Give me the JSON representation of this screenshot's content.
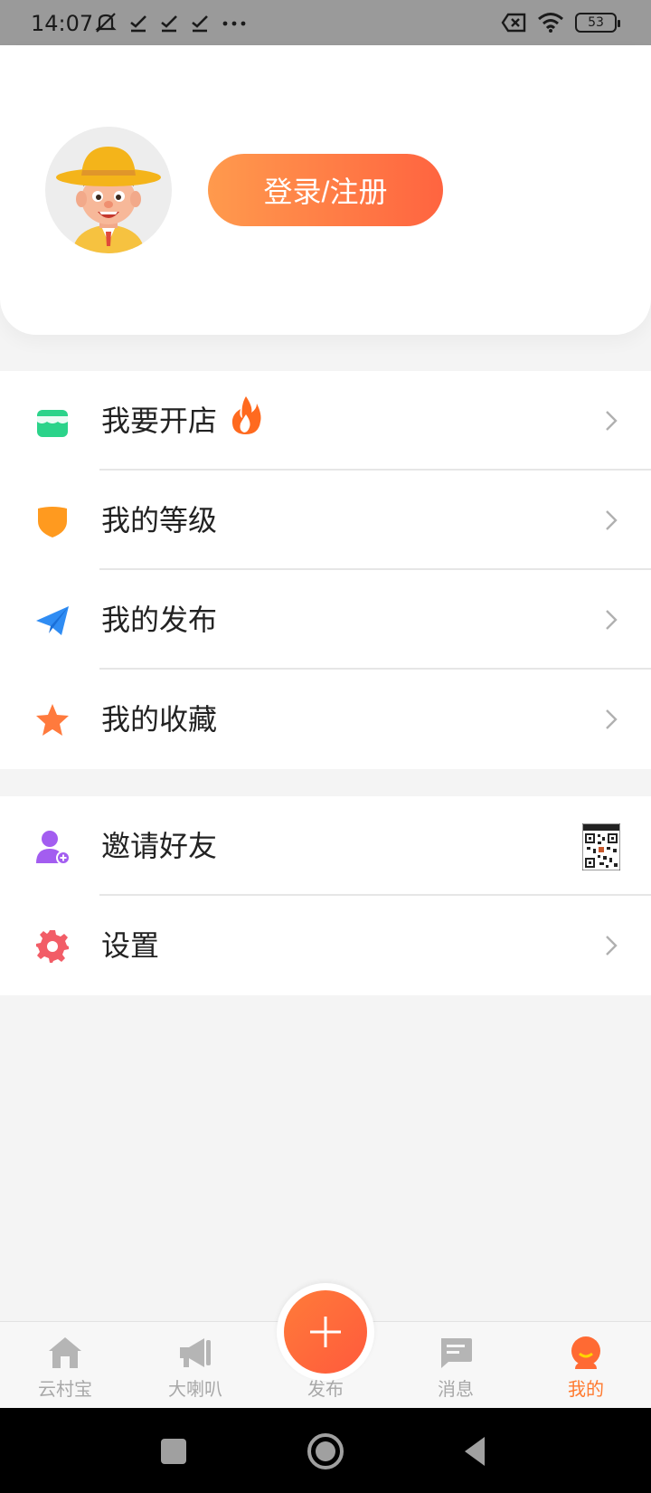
{
  "status_bar": {
    "time": "14:07",
    "battery": "53",
    "left_icons": [
      "mute-icon",
      "check-icon",
      "check-icon",
      "check-icon",
      "more-icon"
    ],
    "right_icons": [
      "sim-off-icon",
      "wifi-icon",
      "battery-icon"
    ]
  },
  "header": {
    "login_label": "登录/注册"
  },
  "menu": {
    "group1": [
      {
        "label": "我要开店",
        "icon": "store-icon",
        "color": "#2bd38a"
      },
      {
        "label": "我的等级",
        "icon": "shield-icon",
        "color": "#ff9a1f"
      },
      {
        "label": "我的发布",
        "icon": "paper-plane-icon",
        "color": "#2f8cf3"
      },
      {
        "label": "我的收藏",
        "icon": "star-icon",
        "color": "#ff7a3d"
      }
    ],
    "group2": [
      {
        "label": "邀请好友",
        "icon": "add-user-icon",
        "color": "#a35df0"
      },
      {
        "label": "设置",
        "icon": "gear-icon",
        "color": "#f25d67"
      }
    ]
  },
  "bottom_nav": {
    "items": [
      {
        "label": "云村宝",
        "icon": "home-icon"
      },
      {
        "label": "大喇叭",
        "icon": "megaphone-icon"
      },
      {
        "label": "发布",
        "icon": "plus-icon"
      },
      {
        "label": "消息",
        "icon": "message-icon"
      },
      {
        "label": "我的",
        "icon": "profile-icon"
      }
    ],
    "active_index": 4,
    "active_color": "#ff7a2f",
    "inactive_color": "#a8a8a8"
  }
}
